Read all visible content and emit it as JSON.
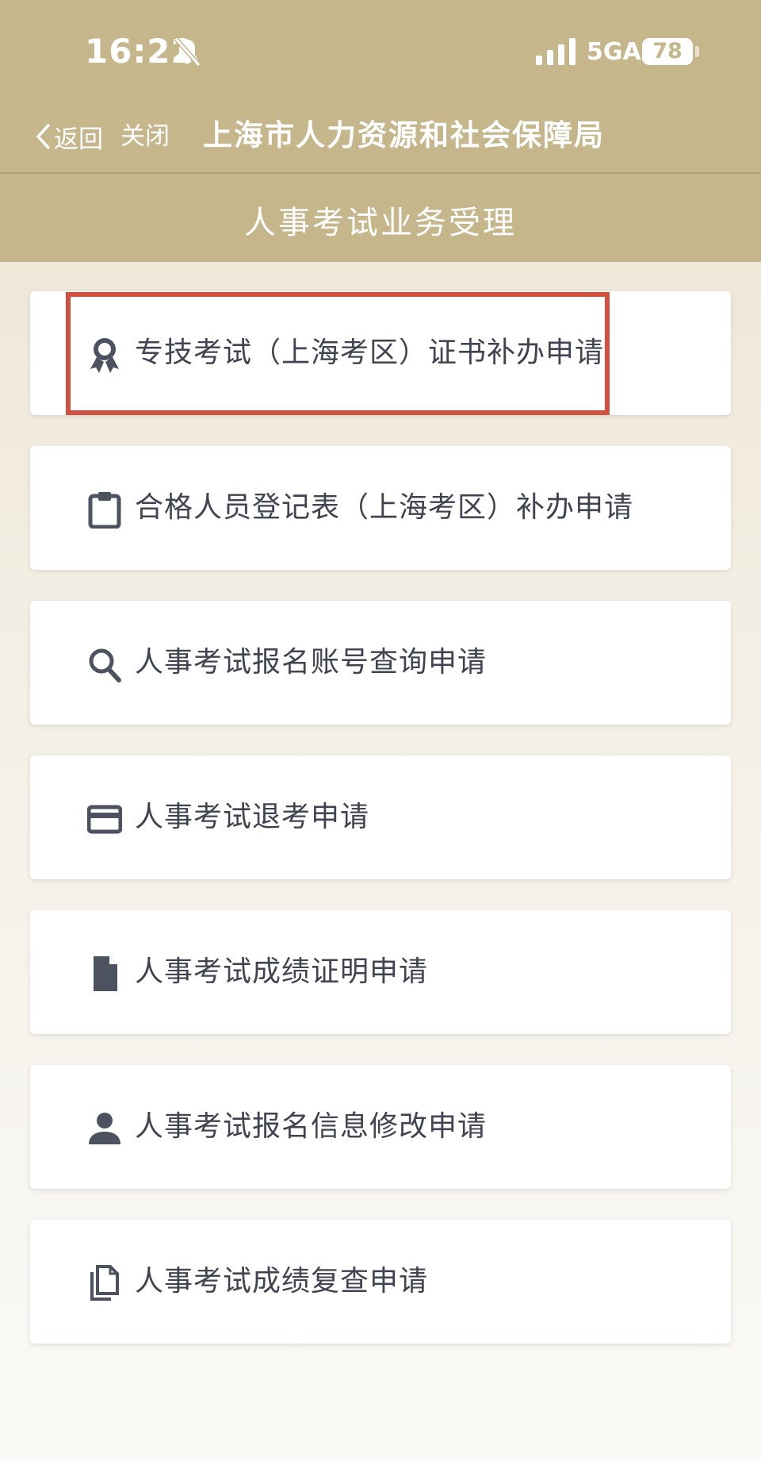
{
  "status_bar": {
    "time": "16:22",
    "network": "5GA",
    "battery": "78",
    "icons": [
      "bell-muted-icon",
      "signal-icon"
    ]
  },
  "navbar": {
    "back_label": "返回",
    "close_label": "关闭",
    "site_title": "上海市人力资源和社会保障局"
  },
  "page_title": "人事考试业务受理",
  "menu": {
    "items": [
      {
        "label": "专技考试（上海考区）证书补办申请",
        "icon": "award-icon"
      },
      {
        "label": "合格人员登记表（上海考区）补办申请",
        "icon": "clipboard-icon"
      },
      {
        "label": "人事考试报名账号查询申请",
        "icon": "search-icon"
      },
      {
        "label": "人事考试退考申请",
        "icon": "card-icon"
      },
      {
        "label": "人事考试成绩证明申请",
        "icon": "document-icon"
      },
      {
        "label": "人事考试报名信息修改申请",
        "icon": "person-icon"
      },
      {
        "label": "人事考试成绩复查申请",
        "icon": "copy-icon"
      }
    ]
  },
  "colors": {
    "header": "#c5b68b",
    "text": "#3f4450",
    "icon": "#4d5260",
    "highlight": "#d1503f"
  }
}
